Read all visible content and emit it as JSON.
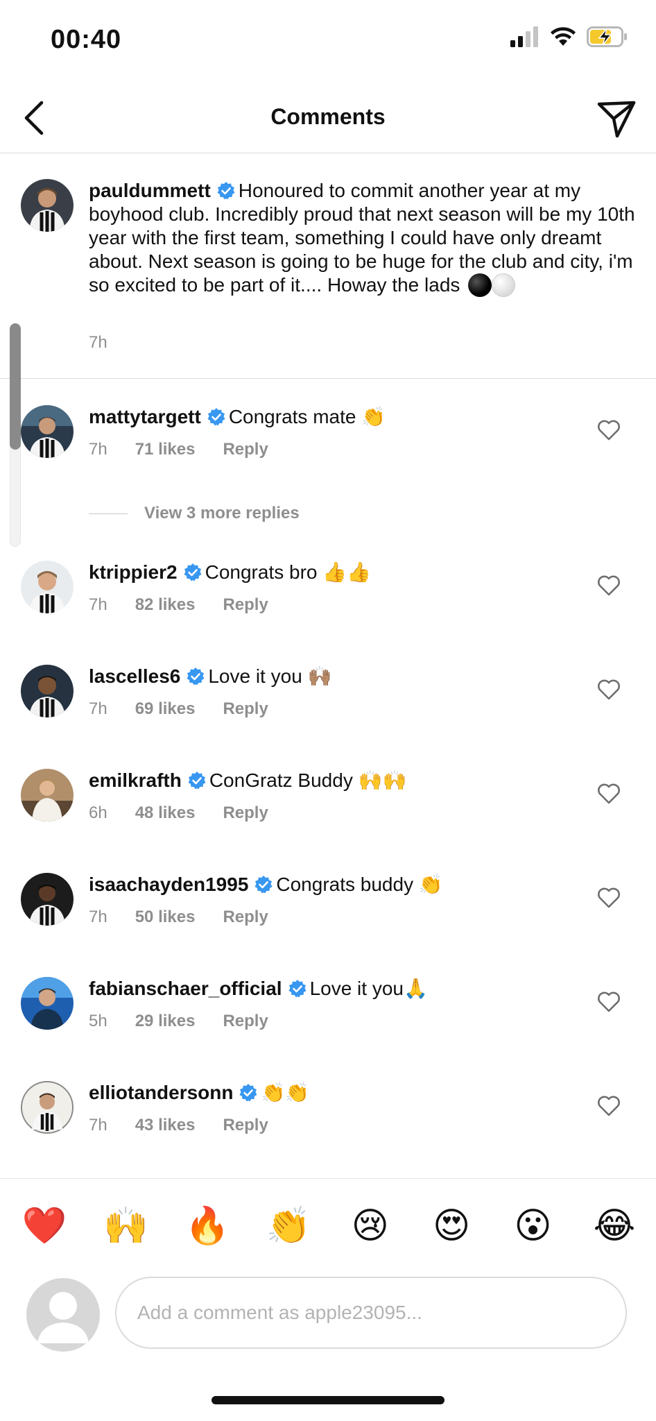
{
  "status_bar": {
    "time": "00:40"
  },
  "nav": {
    "title": "Comments"
  },
  "caption": {
    "username": "pauldummett",
    "text": "Honoured to commit another year at my boyhood club. Incredibly proud that next season will be my 10th year with the first team, something I could have only dreamt about. Next season is going to be huge for the club and city, i'm so excited to be part of it.... Howay the lads",
    "time": "7h"
  },
  "view_more_replies": "View 3 more replies",
  "comments": [
    {
      "username": "mattytargett",
      "text": "Congrats mate 👏",
      "time": "7h",
      "likes": "71 likes",
      "reply": "Reply"
    },
    {
      "username": "ktrippier2",
      "text": "Congrats bro 👍👍",
      "time": "7h",
      "likes": "82 likes",
      "reply": "Reply"
    },
    {
      "username": "lascelles6",
      "text": "Love it you 🙌🏽",
      "time": "7h",
      "likes": "69 likes",
      "reply": "Reply"
    },
    {
      "username": "emilkrafth",
      "text": "ConGratz Buddy 🙌🙌",
      "time": "6h",
      "likes": "48 likes",
      "reply": "Reply"
    },
    {
      "username": "isaachayden1995",
      "text": "Congrats buddy 👏",
      "time": "7h",
      "likes": "50 likes",
      "reply": "Reply"
    },
    {
      "username": "fabianschaer_official",
      "text": "Love it you🙏",
      "time": "5h",
      "likes": "29 likes",
      "reply": "Reply"
    },
    {
      "username": "elliotandersonn",
      "text": "👏👏",
      "time": "7h",
      "likes": "43 likes",
      "reply": "Reply"
    }
  ],
  "quick_emojis": [
    "❤️",
    "🙌",
    "🔥",
    "👏",
    "😢",
    "😍",
    "😮",
    "😂"
  ],
  "compose": {
    "placeholder": "Add a comment as apple23095..."
  },
  "colors": {
    "verified": "#3897f0",
    "meta_gray": "#8e8e8e",
    "divider": "#dbdbdb"
  }
}
